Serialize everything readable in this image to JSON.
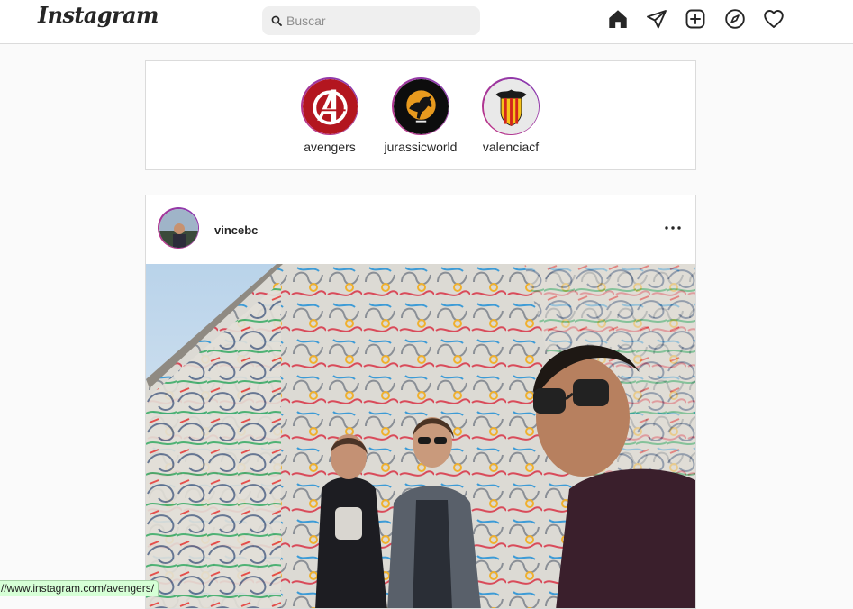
{
  "header": {
    "logo_text": "Instagram",
    "search": {
      "placeholder": "Buscar",
      "value": ""
    },
    "nav_icons": [
      "home-icon",
      "direct-message-icon",
      "new-post-icon",
      "explore-icon",
      "activity-heart-icon"
    ]
  },
  "stories": [
    {
      "username": "avengers"
    },
    {
      "username": "jurassicworld"
    },
    {
      "username": "valenciacf"
    }
  ],
  "post": {
    "username": "vincebc",
    "more_icon": "more-options-icon"
  },
  "status_bar": {
    "url": "//www.instagram.com/avengers/"
  },
  "colors": {
    "story_ring": "#c13584",
    "text": "#262626",
    "placeholder": "#8e8e8e",
    "border": "#dbdbdb",
    "background": "#fafafa"
  }
}
